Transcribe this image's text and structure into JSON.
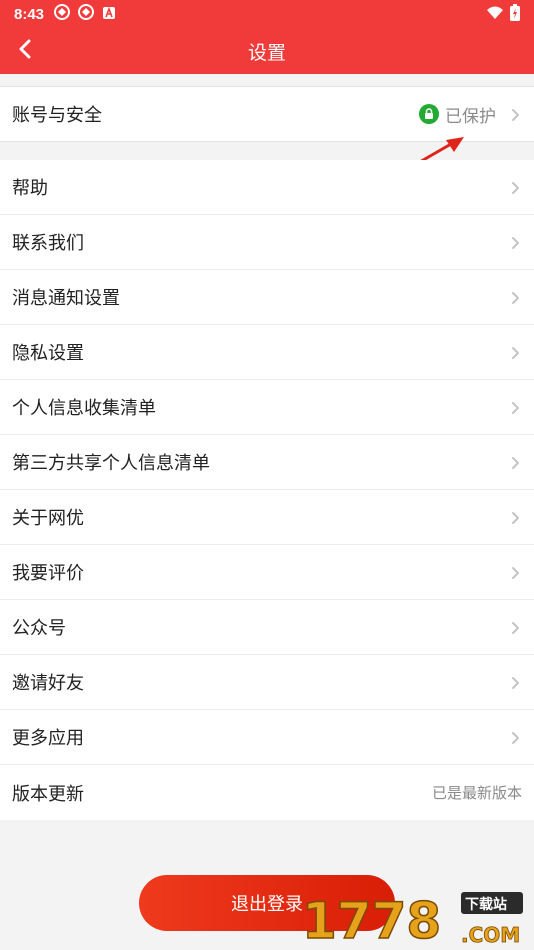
{
  "status_bar": {
    "time": "8:43",
    "notification_icons": [
      "app-notification-icon",
      "app-notification-icon",
      "a-badge-icon"
    ],
    "system_icons": [
      "wifi-icon",
      "battery-charging-icon"
    ]
  },
  "nav": {
    "title": "设置",
    "back_icon": "chevron-left-icon",
    "background": "#f13a3a"
  },
  "account": {
    "label": "账号与安全",
    "status": "已保护",
    "status_icon": "lock-icon",
    "status_color": "#22aa33"
  },
  "menu": {
    "items": [
      {
        "label": "帮助"
      },
      {
        "label": "联系我们"
      },
      {
        "label": "消息通知设置"
      },
      {
        "label": "隐私设置"
      },
      {
        "label": "个人信息收集清单"
      },
      {
        "label": "第三方共享个人信息清单"
      },
      {
        "label": "关于网优"
      },
      {
        "label": "我要评价"
      },
      {
        "label": "公众号"
      },
      {
        "label": "邀请好友"
      },
      {
        "label": "更多应用"
      }
    ],
    "version": {
      "label": "版本更新",
      "value": "已是最新版本"
    }
  },
  "logout": {
    "label": "退出登录"
  },
  "watermark": {
    "text": "1778",
    "domain": ".COM",
    "badge": "下载站"
  }
}
